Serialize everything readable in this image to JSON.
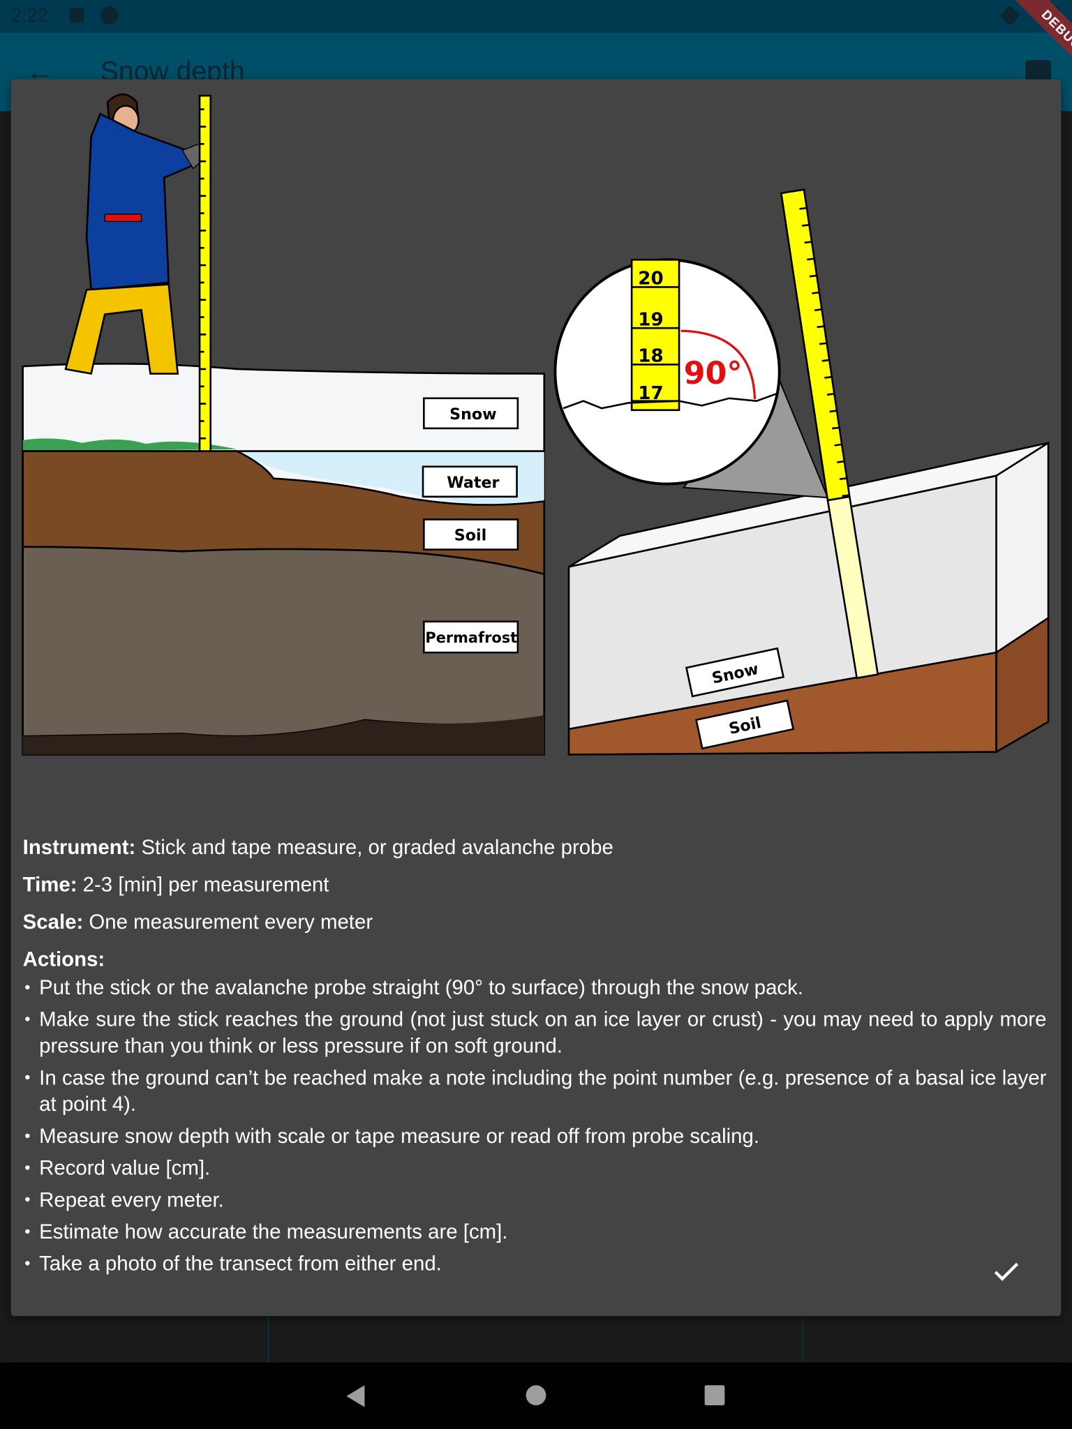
{
  "status_bar": {
    "time": "2:22",
    "debug_banner": "DEBUG"
  },
  "app_bar": {
    "title": "Snow depth",
    "back_icon": "arrow-back-icon",
    "save_icon": "save-icon"
  },
  "illustration": {
    "left_labels": [
      "Snow",
      "Water",
      "Soil",
      "Permafrost"
    ],
    "magnifier_ticks": [
      "20",
      "19",
      "18",
      "17"
    ],
    "angle": "90°",
    "right_labels": [
      "Snow",
      "Soil"
    ]
  },
  "info": {
    "instrument_label": "Instrument:",
    "instrument": " Stick and tape measure, or graded avalanche probe",
    "time_label": "Time:",
    "time": " 2-3 [min] per measurement",
    "scale_label": "Scale:",
    "scale": " One measurement every meter",
    "actions_label": "Actions:",
    "actions": [
      "Put the stick or the avalanche probe straight (90° to surface) through the snow pack.",
      "Make sure the stick reaches the ground (not just stuck on an ice layer or crust) - you may need to apply more pressure than you think or less pressure if on soft ground.",
      "In case the ground can’t be reached make a note including the point number (e.g. presence of a basal ice layer at point 4).",
      "Measure snow depth with scale or tape measure or read off from probe scaling.",
      "Record value [cm].",
      "Repeat every meter.",
      "Estimate how accurate the measurements are [cm].",
      "Take a photo of the transect from either end."
    ]
  },
  "dialog": {
    "confirm_icon": "check-icon"
  },
  "nav_bar": {
    "icons": [
      "back-triangle-icon",
      "home-circle-icon",
      "recents-square-icon"
    ]
  }
}
